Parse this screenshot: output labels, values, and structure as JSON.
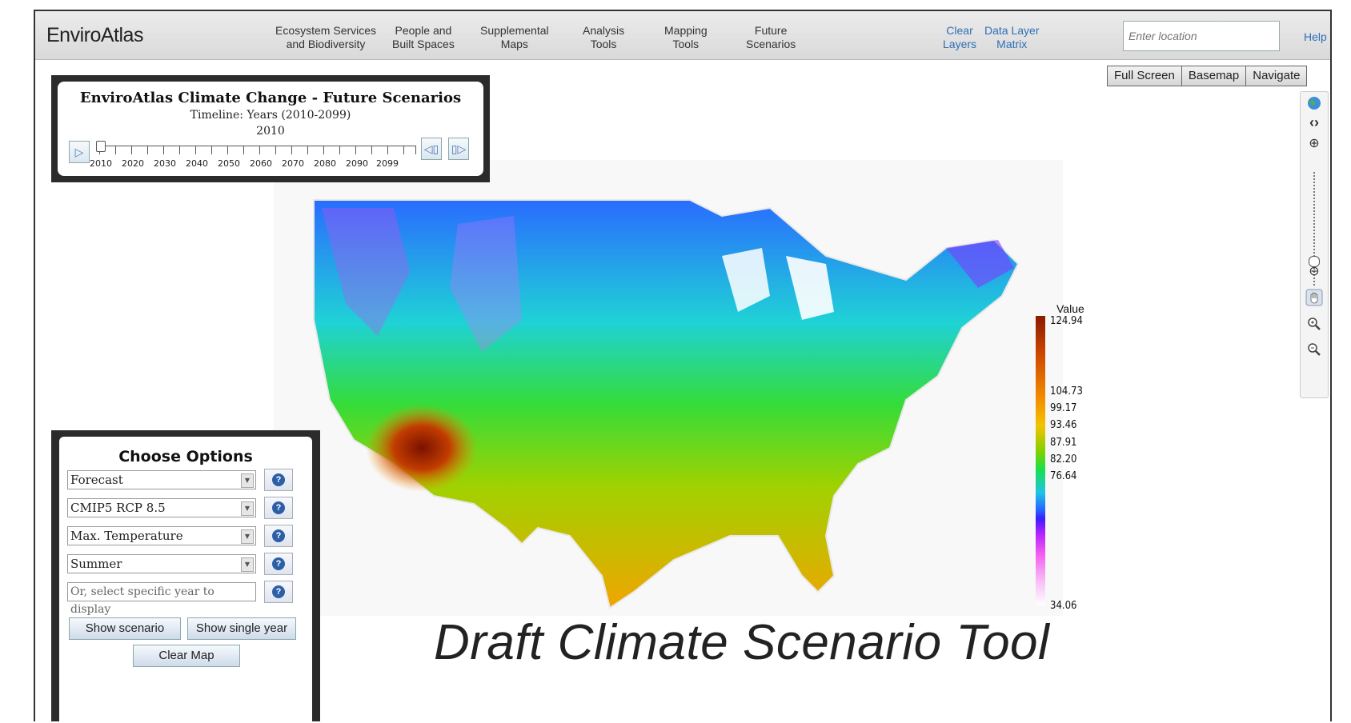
{
  "header": {
    "brand": "EnviroAtlas",
    "nav": [
      {
        "line1": "Ecosystem Services",
        "line2": "and Biodiversity"
      },
      {
        "line1": "People and",
        "line2": "Built Spaces"
      },
      {
        "line1": "Supplemental",
        "line2": "Maps"
      },
      {
        "line1": "Analysis",
        "line2": "Tools"
      },
      {
        "line1": "Mapping",
        "line2": "Tools"
      },
      {
        "line1": "Future",
        "line2": "Scenarios"
      }
    ],
    "links": [
      {
        "line1": "Clear",
        "line2": "Layers"
      },
      {
        "line1": "Data Layer",
        "line2": "Matrix"
      }
    ],
    "location_placeholder": "Enter location",
    "help": "Help"
  },
  "view_buttons": [
    "Full Screen",
    "Basemap",
    "Navigate"
  ],
  "timeline": {
    "title": "EnviroAtlas Climate Change - Future Scenarios",
    "subtitle": "Timeline: Years (2010-2099)",
    "current_year": "2010",
    "tick_labels": [
      "2010",
      "2020",
      "2030",
      "2040",
      "2050",
      "2060",
      "2070",
      "2080",
      "2090",
      "2099"
    ]
  },
  "legend": {
    "title": "Value",
    "values": [
      "124.94",
      "104.73",
      "99.17",
      "93.46",
      "87.91",
      "82.20",
      "76.64",
      "34.06"
    ]
  },
  "options": {
    "title": "Choose Options",
    "selects": [
      "Forecast",
      "CMIP5 RCP 8.5",
      "Max. Temperature",
      "Summer"
    ],
    "year_placeholder": "Or, select specific year to display",
    "show_scenario": "Show scenario",
    "show_single_year": "Show single year",
    "clear_map": "Clear Map"
  },
  "caption": "Draft Climate Scenario Tool"
}
